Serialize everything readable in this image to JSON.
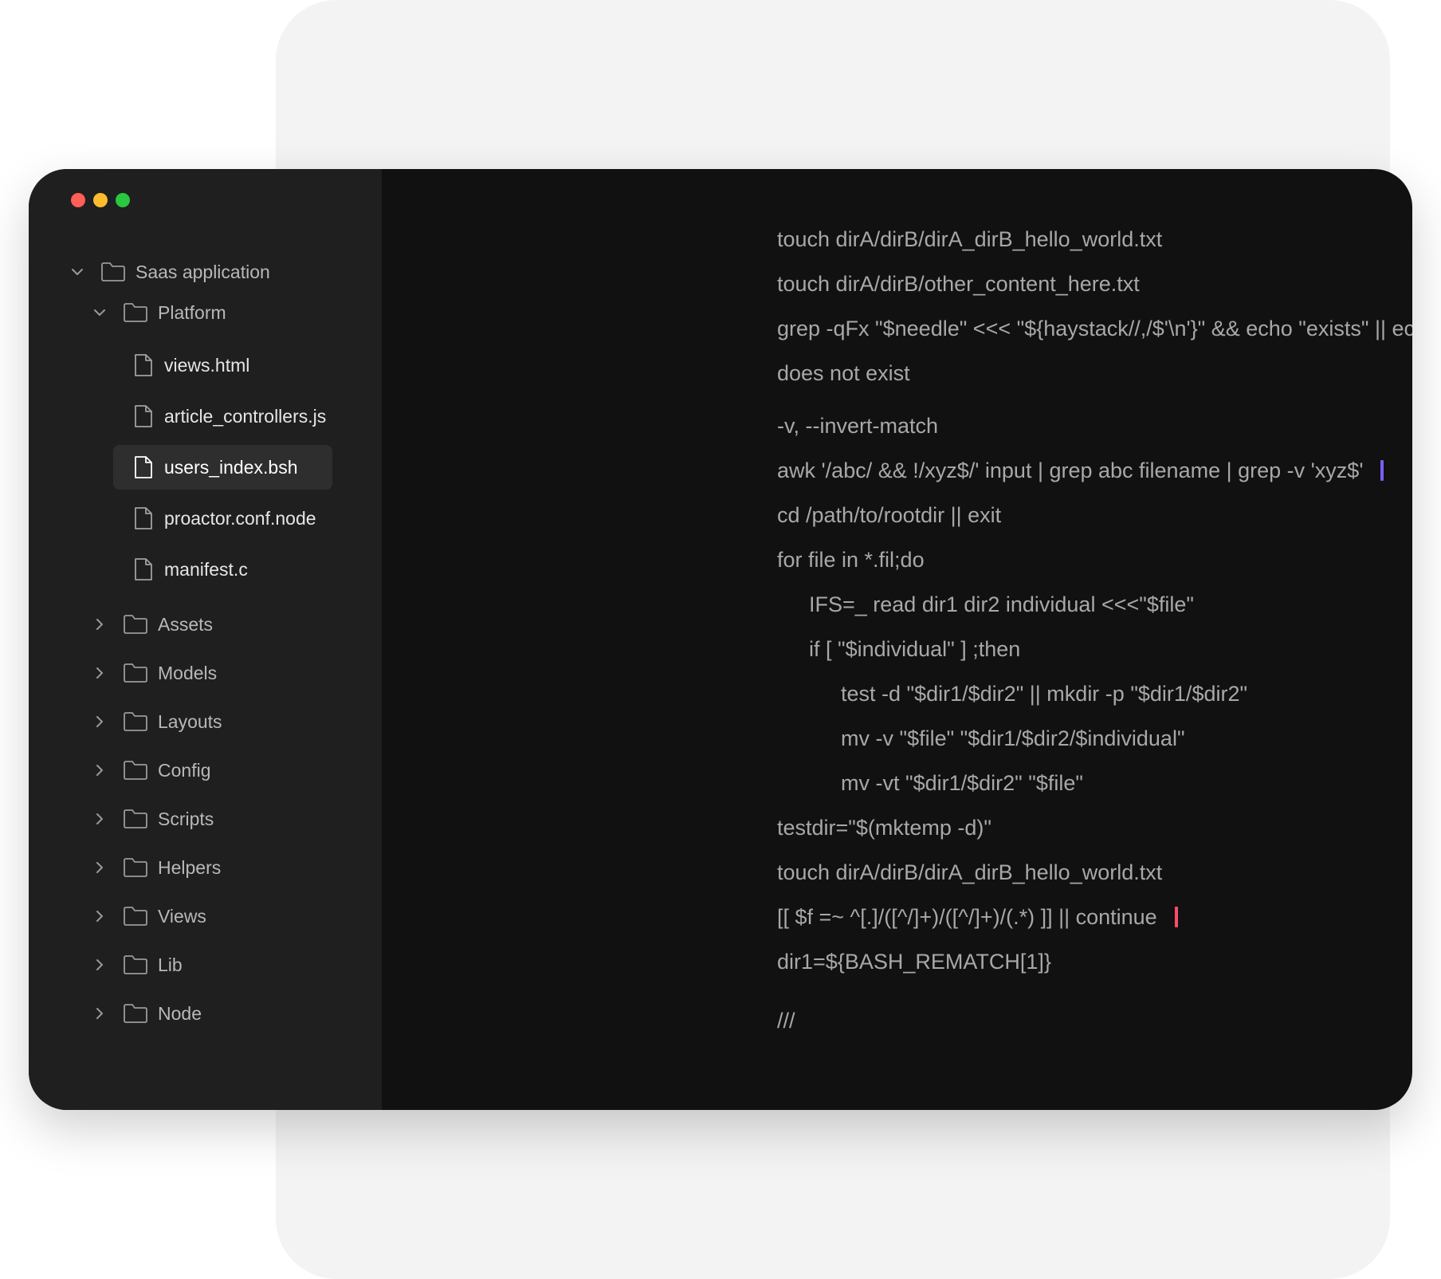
{
  "colors": {
    "backdrop": "#f3f3f3",
    "window_bg": "#111111",
    "sidebar_bg": "#1f1f1f",
    "selected_bg": "#2e2e2e",
    "traffic_close": "#ff5f57",
    "traffic_minimize": "#febc2e",
    "traffic_zoom": "#28c840",
    "caret_purple": "#7b5cff",
    "caret_red": "#ff4d67"
  },
  "sidebar": {
    "root": {
      "label": "Saas application",
      "icon": "folder-icon",
      "expanded": true
    },
    "platform": {
      "label": "Platform",
      "icon": "folder-icon",
      "expanded": true
    },
    "files": [
      {
        "label": "views.html",
        "icon": "file-icon",
        "selected": false
      },
      {
        "label": "article_controllers.js",
        "icon": "file-icon",
        "selected": false
      },
      {
        "label": "users_index.bsh",
        "icon": "file-icon",
        "selected": true
      },
      {
        "label": "proactor.conf.node",
        "icon": "file-icon",
        "selected": false
      },
      {
        "label": "manifest.c",
        "icon": "file-icon",
        "selected": false
      }
    ],
    "folders": [
      {
        "label": "Assets",
        "icon": "folder-icon",
        "expanded": false
      },
      {
        "label": "Models",
        "icon": "folder-icon",
        "expanded": false
      },
      {
        "label": "Layouts",
        "icon": "folder-icon",
        "expanded": false
      },
      {
        "label": "Config",
        "icon": "folder-icon",
        "expanded": false
      },
      {
        "label": "Scripts",
        "icon": "folder-icon",
        "expanded": false
      },
      {
        "label": "Helpers",
        "icon": "folder-icon",
        "expanded": false
      },
      {
        "label": "Views",
        "icon": "folder-icon",
        "expanded": false
      },
      {
        "label": "Lib",
        "icon": "folder-icon",
        "expanded": false
      },
      {
        "label": "Node",
        "icon": "folder-icon",
        "expanded": false
      }
    ]
  },
  "editor": {
    "lines": [
      {
        "text": "touch dirA/dirB/dirA_dirB_hello_world.txt",
        "indent": 0
      },
      {
        "text": "touch dirA/dirB/other_content_here.txt",
        "indent": 0
      },
      {
        "text": "grep -qFx \"$needle\" <<< \"${haystack//,/$'\\n'}\" && echo \"exists\" || echo \"does not exist\"",
        "indent": 0
      },
      {
        "text": "does not exist",
        "indent": 0
      },
      {
        "text": "-v, --invert-match",
        "indent": 0
      },
      {
        "text": "awk '/abc/ && !/xyz$/' input | grep abc filename | grep -v 'xyz$'",
        "indent": 0,
        "caret": "purple"
      },
      {
        "text": "cd /path/to/rootdir || exit",
        "indent": 0
      },
      {
        "text": "for file in *.fil;do",
        "indent": 0
      },
      {
        "text": "IFS=_ read dir1 dir2 individual <<<\"$file\"",
        "indent": 1
      },
      {
        "text": "if [ \"$individual\" ] ;then",
        "indent": 1
      },
      {
        "text": "test -d \"$dir1/$dir2\" || mkdir -p \"$dir1/$dir2\"",
        "indent": 2
      },
      {
        "text": "mv -v \"$file\" \"$dir1/$dir2/$individual\"",
        "indent": 2
      },
      {
        "text": "mv -vt \"$dir1/$dir2\" \"$file\"",
        "indent": 2
      },
      {
        "text": "testdir=\"$(mktemp -d)\"",
        "indent": 0
      },
      {
        "text": "touch dirA/dirB/dirA_dirB_hello_world.txt",
        "indent": 0
      },
      {
        "text": "[[ $f =~ ^[.]/([^/]+)/([^/]+)/(.*) ]] || continue",
        "indent": 0,
        "caret": "red"
      },
      {
        "text": "dir1=${BASH_REMATCH[1]}",
        "indent": 0
      },
      {
        "text": "///",
        "indent": 0
      }
    ]
  }
}
